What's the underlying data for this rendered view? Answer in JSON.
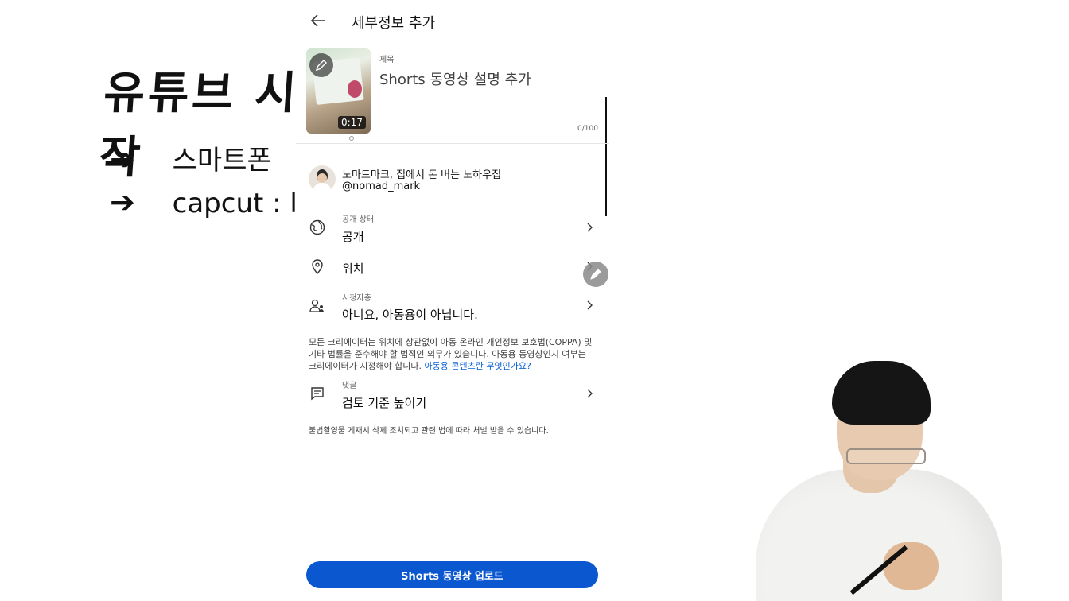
{
  "board": {
    "title": "유튜브 시작",
    "lines": [
      {
        "arrow": "➔",
        "text": "스마트폰"
      },
      {
        "arrow": "➔",
        "text": "capcut : l"
      }
    ]
  },
  "appbar": {
    "title": "세부정보 추가",
    "back_icon": "arrow-left-icon"
  },
  "video": {
    "duration": "0:17",
    "edit_icon": "pencil-icon"
  },
  "title_field": {
    "label": "제목",
    "value": "Shorts 동영상 설명 추가",
    "counter": "0/100"
  },
  "channel": {
    "name": "노마드마크, 집에서 돈 버는 노하우집",
    "handle": "@nomad_mark"
  },
  "rows": [
    {
      "sub": "공개 상태",
      "value": "공개",
      "icon": "globe-icon"
    },
    {
      "sub": "",
      "value": "위치",
      "icon": "location-pin-icon"
    },
    {
      "sub": "시청자층",
      "value": "아니요, 아동용이 아닙니다.",
      "icon": "audience-icon"
    },
    {
      "sub": "댓글",
      "value": "검토 기준 높이기",
      "icon": "comment-icon"
    }
  ],
  "coppa": {
    "text": "모든 크리에이터는 위치에 상관없이 아동 온라인 개인정보 보호법(COPPA) 및 기타 법률을 준수해야 할 법적인 의무가 있습니다. 아동용 동영상인지 여부는 크리에이터가 지정해야 합니다. ",
    "link": "아동용 콘텐츠란 무엇인가요?"
  },
  "illegal_notice": "불법촬영물 게재시 삭제 조치되고 관련 법에 따라 처벌 받을 수 있습니다.",
  "upload_button": "Shorts 동영상 업로드",
  "colors": {
    "accent": "#0b57d0",
    "link": "#065fd4"
  }
}
